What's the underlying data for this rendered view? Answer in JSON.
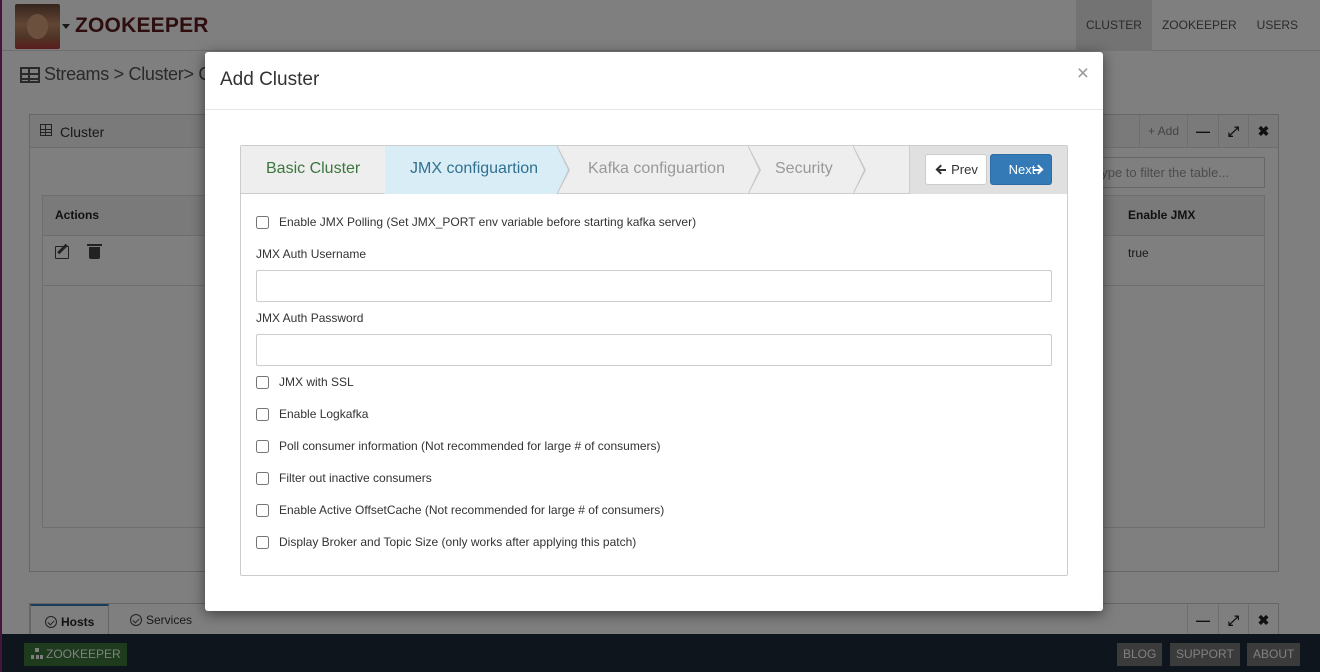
{
  "app": {
    "brand": "ZOOKEEPER",
    "nav": [
      "CLUSTER",
      "ZOOKEEPER",
      "USERS"
    ]
  },
  "breadcrumb": "Streams > Cluster> Clust",
  "cluster_panel": {
    "title": "Cluster",
    "add_label": "Add",
    "filter_placeholder": "Type to filter the table...",
    "columns": {
      "actions": "Actions",
      "enable_jmx": "Enable JMX"
    },
    "rows": [
      {
        "enable_jmx": "true"
      }
    ]
  },
  "bottom_panel": {
    "tabs": [
      "Hosts",
      "Services"
    ]
  },
  "footer": {
    "left_button": "ZOOKEEPER",
    "right_buttons": [
      "BLOG",
      "SUPPORT",
      "ABOUT"
    ]
  },
  "modal": {
    "title": "Add Cluster",
    "close": "×",
    "steps": [
      "Basic Cluster",
      "JMX configuartion",
      "Kafka configuartion",
      "Security"
    ],
    "prev_label": "Prev",
    "next_label": "Next",
    "form": {
      "enable_jmx_polling": "Enable JMX Polling (Set JMX_PORT env variable before starting kafka server)",
      "jmx_username_label": "JMX Auth Username",
      "jmx_username_value": "",
      "jmx_password_label": "JMX Auth Password",
      "jmx_password_value": "",
      "jmx_ssl": "JMX with SSL",
      "enable_logkafka": "Enable Logkafka",
      "poll_consumer": "Poll consumer information (Not recommended for large # of consumers)",
      "filter_inactive": "Filter out inactive consumers",
      "active_offset_cache": "Enable Active OffsetCache (Not recommended for large # of consumers)",
      "display_broker_topic_size": "Display Broker and Topic Size (only works after applying this patch)"
    }
  },
  "colors": {
    "primary": "#337ab7",
    "step_done": "#3c763d",
    "step_current": "#31708f",
    "footer_bg": "#1e2a38"
  }
}
